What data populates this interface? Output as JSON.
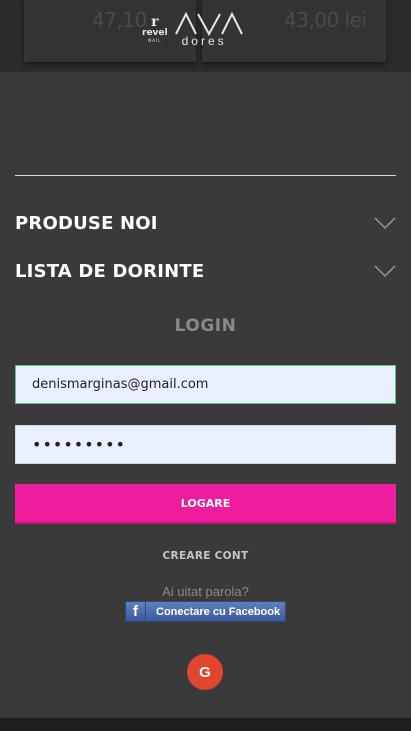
{
  "header": {
    "price_left": "47,10",
    "price_right": "43,00 lei",
    "logo_revel": "revel",
    "logo_revel_sub": "NAIL",
    "logo_ava": "AVA",
    "logo_dores": "dores"
  },
  "menu": {
    "items": [
      {
        "label": "PRODUSE NOI",
        "icon": "chevron-down-icon"
      },
      {
        "label": "LISTA DE DORINTE",
        "icon": "chevron-down-icon"
      }
    ]
  },
  "login": {
    "title": "LOGIN",
    "email_value": "denismarginas@gmail.com",
    "password_value": "•••••••••",
    "submit_label": "LOGARE",
    "create_account_label": "CREARE CONT",
    "forgot_password_label": "Ai uitat parola?",
    "facebook_label": "Conectare cu Facebook",
    "facebook_icon": "f",
    "google_icon": "G"
  },
  "colors": {
    "background": "#3a3a3a",
    "accent_pink": "#ee1d9e",
    "facebook_blue": "#3b5a9a",
    "google_red": "#e0462c",
    "input_bg": "#e8f0fe"
  }
}
